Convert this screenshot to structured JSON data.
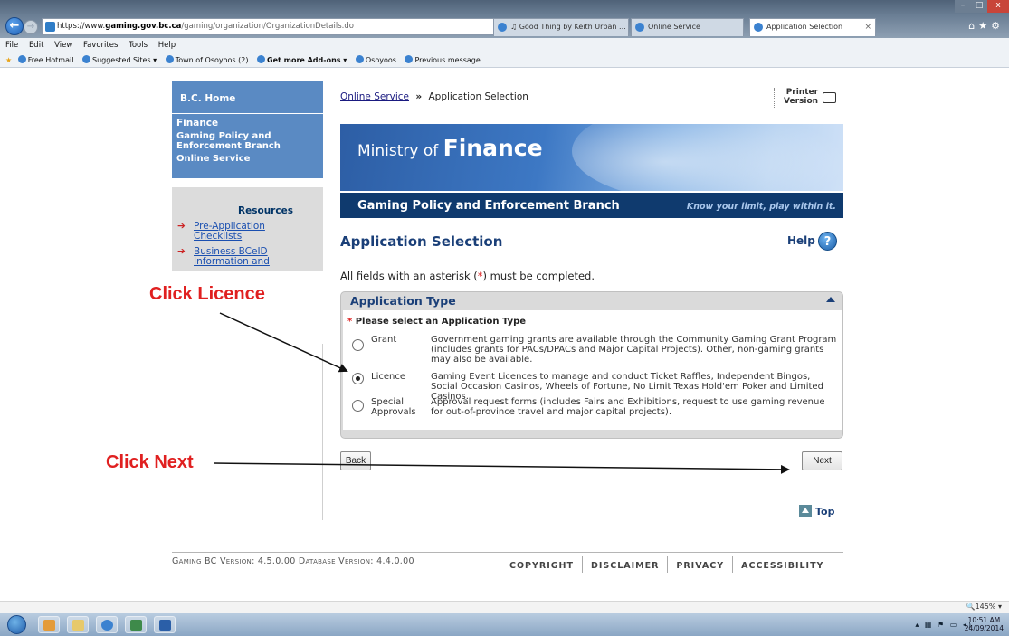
{
  "browser": {
    "url_prefix": "https://www.",
    "url_domain": "gaming.gov.bc.ca",
    "url_path": "/gaming/organization/OrganizationDetails.do",
    "addr_tools": "⌕ ▾ 🔒 C",
    "tabs": [
      {
        "label": "♫ Good Thing by Keith Urban ..."
      },
      {
        "label": "Online Service"
      },
      {
        "label": "Application Selection"
      }
    ],
    "menu": [
      "File",
      "Edit",
      "View",
      "Favorites",
      "Tools",
      "Help"
    ],
    "favorites": [
      "Free Hotmail",
      "Suggested Sites ▾",
      "Town of Osoyoos (2)",
      "Get more Add-ons ▾",
      "Osoyoos",
      "Previous message"
    ],
    "zoom": "🔍145%  ▾",
    "clock_time": "10:51 AM",
    "clock_date": "24/09/2014"
  },
  "sidebar": {
    "home": "B.C. Home",
    "finance": "Finance",
    "gaming_line1": "Gaming Policy and",
    "gaming_line2": "Enforcement Branch",
    "online": "Online Service",
    "resources_title": "Resources",
    "links": [
      {
        "line1": "Pre-Application",
        "line2": "Checklists"
      },
      {
        "line1": "Business BCeID",
        "line2": "Information and"
      }
    ]
  },
  "breadcrumb": {
    "link": "Online Service",
    "sep": "»",
    "current": "Application Selection"
  },
  "printer": {
    "line1": "Printer",
    "line2": "Version"
  },
  "banner": {
    "ministry_of": "Ministry of",
    "finance": "Finance",
    "branch": "Gaming Policy and Enforcement Branch",
    "tagline": "Know your limit, play within it."
  },
  "page": {
    "title": "Application Selection",
    "help": "Help",
    "required_pre": "All fields with an asterisk (",
    "required_ast": "*",
    "required_post": ") must be completed."
  },
  "application_type": {
    "title": "Application Type",
    "select_label": "Please select an Application Type",
    "options": [
      {
        "label": "Grant",
        "label2": "",
        "checked": false,
        "desc": "Government gaming grants are available through the Community Gaming Grant Program (includes grants for PACs/DPACs and Major Capital Projects). Other, non-gaming grants may also be available."
      },
      {
        "label": "Licence",
        "label2": "",
        "checked": true,
        "desc": "Gaming Event Licences to manage and conduct Ticket Raffles, Independent Bingos, Social Occasion Casinos, Wheels of Fortune, No Limit Texas Hold'em Poker and Limited Casinos."
      },
      {
        "label": "Special",
        "label2": "Approvals",
        "checked": false,
        "desc": "Approval request forms (includes Fairs and Exhibitions, request to use gaming revenue for out-of-province travel and major capital projects)."
      }
    ]
  },
  "buttons": {
    "back": "Back",
    "next": "Next",
    "top": "Top"
  },
  "footer": {
    "version": "Gaming BC Version: 4.5.0.00 Database Version: 4.4.0.00",
    "links": [
      "COPYRIGHT",
      "DISCLAIMER",
      "PRIVACY",
      "ACCESSIBILITY"
    ]
  },
  "annotations": {
    "licence": "Click Licence",
    "next": "Click Next"
  }
}
